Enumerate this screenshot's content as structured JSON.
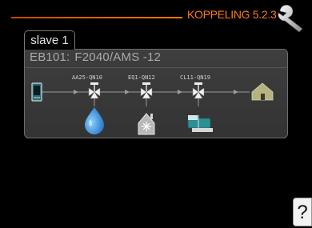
{
  "header": {
    "title": "KOPPELING 5.2.3",
    "accent_color": "#ff7a1a",
    "icon": "wrench-icon"
  },
  "tab": {
    "label": "slave 1"
  },
  "device": {
    "id": "EB101:",
    "model": "F2040/AMS -12"
  },
  "diagram": {
    "valves": [
      {
        "label": "AA25-QN10",
        "target": "water-drop-icon"
      },
      {
        "label": "EQ1-QN12",
        "target": "cooling-unit-icon"
      },
      {
        "label": "CL11-QN19",
        "target": "pool-heater-icon"
      }
    ],
    "source": "outdoor-unit-icon",
    "sink": "house-icon"
  },
  "help": {
    "label": "?"
  }
}
